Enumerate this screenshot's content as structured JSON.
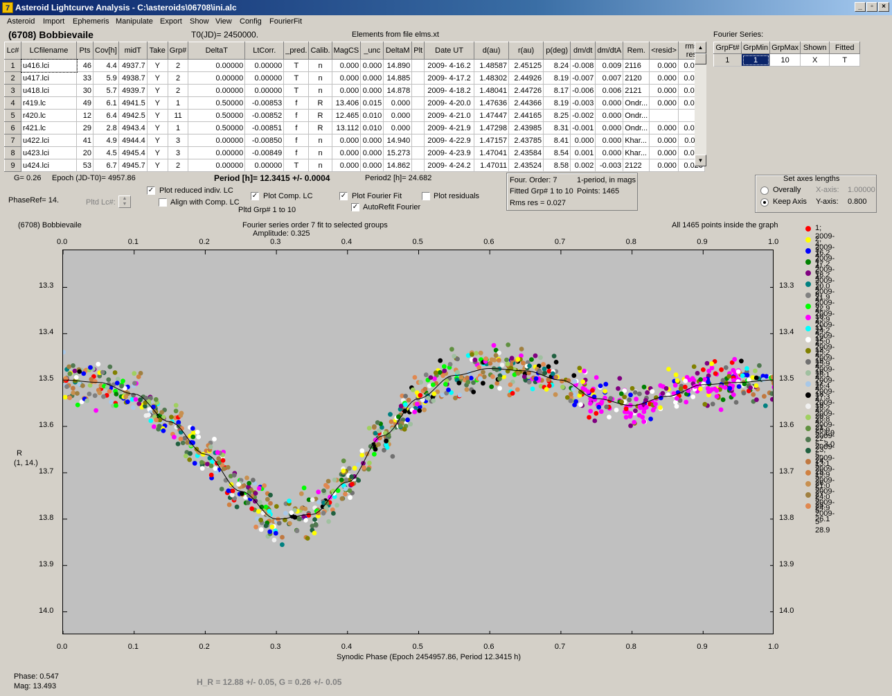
{
  "window": {
    "title": "Asteroid Lightcurve Analysis - C:\\asteroids\\06708\\ini.alc",
    "icon": "app-icon"
  },
  "menu": [
    "Asteroid",
    "Import",
    "Ephemeris",
    "Manipulate",
    "Export",
    "Show",
    "View",
    "Config",
    "FourierFit"
  ],
  "header": {
    "asteroid": "(6708) Bobbievaile",
    "t0": "T0(JD)= 2450000.",
    "elements": "Elements from file elms.xt",
    "fourier_label": "Fourier Series:"
  },
  "table": {
    "columns": [
      "Lc#",
      "LCfilename",
      "Pts",
      "Cov[h]",
      "midT",
      "Take",
      "Grp#",
      "DeltaT",
      "LtCorr.",
      "_pred.",
      "Calib.",
      "MagCS",
      "_unc",
      "DeltaM",
      "Plt",
      "Date UT",
      "d(au)",
      "r(au)",
      "p(deg)",
      "dm/dt",
      "dm/dtA",
      "Rem.",
      "<resid>",
      "rms res"
    ],
    "rows": [
      [
        "1",
        "u416.lci",
        "46",
        "4.4",
        "4937.7",
        "Y",
        "2",
        "0.00000",
        "0.00000",
        "T",
        "n",
        "0.000",
        "0.000",
        "14.890",
        "",
        "2009- 4-16.2",
        "1.48587",
        "2.45125",
        "8.24",
        "-0.008",
        "0.009",
        "2116",
        "0.000",
        "0.024"
      ],
      [
        "2",
        "u417.lci",
        "33",
        "5.9",
        "4938.7",
        "Y",
        "2",
        "0.00000",
        "0.00000",
        "T",
        "n",
        "0.000",
        "0.000",
        "14.885",
        "",
        "2009- 4-17.2",
        "1.48302",
        "2.44926",
        "8.19",
        "-0.007",
        "0.007",
        "2120",
        "0.000",
        "0.029"
      ],
      [
        "3",
        "u418.lci",
        "30",
        "5.7",
        "4939.7",
        "Y",
        "2",
        "0.00000",
        "0.00000",
        "T",
        "n",
        "0.000",
        "0.000",
        "14.878",
        "",
        "2009- 4-18.2",
        "1.48041",
        "2.44726",
        "8.17",
        "-0.006",
        "0.006",
        "2121",
        "0.000",
        "0.022"
      ],
      [
        "4",
        "r419.lc",
        "49",
        "6.1",
        "4941.5",
        "Y",
        "1",
        "0.50000",
        "-0.00853",
        "f",
        "R",
        "13.406",
        "0.015",
        "0.000",
        "",
        "2009- 4-20.0",
        "1.47636",
        "2.44366",
        "8.19",
        "-0.003",
        "0.000",
        "Ondr...",
        "0.000",
        "0.026"
      ],
      [
        "5",
        "r420.lc",
        "12",
        "6.4",
        "4942.5",
        "Y",
        "11",
        "0.50000",
        "-0.00852",
        "f",
        "R",
        "12.465",
        "0.010",
        "0.000",
        "",
        "2009- 4-21.0",
        "1.47447",
        "2.44165",
        "8.25",
        "-0.002",
        "0.000",
        "Ondr...",
        "",
        ""
      ],
      [
        "6",
        "r421.lc",
        "29",
        "2.8",
        "4943.4",
        "Y",
        "1",
        "0.50000",
        "-0.00851",
        "f",
        "R",
        "13.112",
        "0.010",
        "0.000",
        "",
        "2009- 4-21.9",
        "1.47298",
        "2.43985",
        "8.31",
        "-0.001",
        "0.000",
        "Ondr...",
        "0.000",
        "0.017"
      ],
      [
        "7",
        "u422.lci",
        "41",
        "4.9",
        "4944.4",
        "Y",
        "3",
        "0.00000",
        "-0.00850",
        "f",
        "n",
        "0.000",
        "0.000",
        "14.940",
        "",
        "2009- 4-22.9",
        "1.47157",
        "2.43785",
        "8.41",
        "0.000",
        "0.000",
        "Khar...",
        "0.000",
        "0.011"
      ],
      [
        "8",
        "u423.lci",
        "20",
        "4.5",
        "4945.4",
        "Y",
        "3",
        "0.00000",
        "-0.00849",
        "f",
        "n",
        "0.000",
        "0.000",
        "15.273",
        "",
        "2009- 4-23.9",
        "1.47041",
        "2.43584",
        "8.54",
        "0.001",
        "0.000",
        "Khar...",
        "0.000",
        "0.023"
      ],
      [
        "9",
        "u424.lci",
        "53",
        "6.7",
        "4945.7",
        "Y",
        "2",
        "0.00000",
        "0.00000",
        "T",
        "n",
        "0.000",
        "0.000",
        "14.862",
        "",
        "2009- 4-24.2",
        "1.47011",
        "2.43524",
        "8.58",
        "0.002",
        "-0.003",
        "2122",
        "0.000",
        "0.026"
      ]
    ]
  },
  "fourier_table": {
    "columns": [
      "GrpFt#",
      "GrpMin",
      "GrpMax",
      "Shown",
      "Fitted"
    ],
    "row": [
      "1",
      "1",
      "10",
      "X",
      "T"
    ]
  },
  "controls": {
    "g": "G= 0.26",
    "epoch": "Epoch (JD-T0)= 4957.86",
    "period": "Period [h]= 12.3415 +/- 0.0004",
    "period2": "Period2 [h]= 24.682",
    "phaseref": "PhaseRef= 14.",
    "pltd_lc": "Pltd Lc#:",
    "plot_reduced": "Plot reduced indiv. LC",
    "align": "Align with Comp. LC",
    "plot_comp": "Plot Comp. LC",
    "pltd_grp": "Pltd Grp#  1   to   10",
    "plot_fourier": "Plot Fourier Fit",
    "autorefit": "AutoRefit Fourier",
    "plot_resid": "Plot residuals",
    "four_order": "Four. Order:  7",
    "one_period": "1-period, in mags",
    "fitted_grp": "Fitted Grp# 1 to 10",
    "points": "Points: 1465",
    "rms": "Rms res      = 0.027",
    "axes_title": "Set axes lengths",
    "overally": "Overally",
    "keep_axis": "Keep Axis",
    "xaxis_label": "X-axis:",
    "xaxis_val": "1.00000",
    "yaxis_label": "Y-axis:",
    "yaxis_val": "0.800"
  },
  "plot": {
    "left_title": "(6708) Bobbievaile",
    "center_title": "Fourier series order 7 fit to selected groups",
    "amplitude": "Amplitude: 0.325",
    "right_title": "All 1465 points inside the graph",
    "ylabel": "R",
    "ylabel2": "(1, 14.)",
    "xlabel": "Synodic Phase (Epoch 2454957.86, Period 12.3415 h)",
    "phase": "Phase:  0.547",
    "mag": "Mag:    13.493",
    "hr": "H_R = 12.88 +/- 0.05, G = 0.26 +/- 0.05"
  },
  "chart_data": {
    "type": "scatter",
    "title": "Fourier series order 7 fit to selected groups",
    "xlabel": "Synodic Phase (Epoch 2454957.86, Period 12.3415 h)",
    "ylabel": "R",
    "xlim": [
      0.0,
      1.0
    ],
    "ylim": [
      14.05,
      13.22
    ],
    "xticks": [
      "0.0",
      "0.1",
      "0.2",
      "0.3",
      "0.4",
      "0.5",
      "0.6",
      "0.7",
      "0.8",
      "0.9",
      "1.0"
    ],
    "yticks": [
      "13.3",
      "13.4",
      "13.5",
      "13.6",
      "13.7",
      "13.8",
      "13.9",
      "14.0"
    ],
    "fit_curve": {
      "x": [
        0.0,
        0.05,
        0.1,
        0.15,
        0.2,
        0.25,
        0.3,
        0.35,
        0.4,
        0.45,
        0.5,
        0.55,
        0.6,
        0.65,
        0.7,
        0.75,
        0.8,
        0.85,
        0.9,
        0.95,
        1.0
      ],
      "y": [
        13.5,
        13.505,
        13.53,
        13.59,
        13.66,
        13.74,
        13.8,
        13.79,
        13.72,
        13.62,
        13.54,
        13.49,
        13.475,
        13.48,
        13.5,
        13.54,
        13.555,
        13.535,
        13.51,
        13.505,
        13.5
      ]
    },
    "series": [
      {
        "name": "1; 2009- 4-16.2",
        "color": "#ff0000"
      },
      {
        "name": "2; 2009- 4-17.2",
        "color": "#ffff00"
      },
      {
        "name": "3; 2009- 4-18.2",
        "color": "#0000ff"
      },
      {
        "name": "4; 2009- 4-20.0",
        "color": "#008000"
      },
      {
        "name": "6; 2009- 4-21.9",
        "color": "#800080"
      },
      {
        "name": "7; 2009- 4-22.9",
        "color": "#008080"
      },
      {
        "name": "8; 2009- 4-23.9",
        "color": "#808080"
      },
      {
        "name": "9; 2009- 4-24.2",
        "color": "#00ff00"
      },
      {
        "name": "10; 2009- 4-25.0",
        "color": "#ff00ff"
      },
      {
        "name": "11; 2009- 4-25.2",
        "color": "#00ffff"
      },
      {
        "name": "12; 2009- 4-25.9",
        "color": "#ffffff"
      },
      {
        "name": "13; 2009- 4-26.1",
        "color": "#808000"
      },
      {
        "name": "15; 2009- 4-26.4",
        "color": "#707070"
      },
      {
        "name": "16; 2009- 4-27.3",
        "color": "#a0c0a0"
      },
      {
        "name": "17; 2009- 4-28.2",
        "color": "#a8c8e8"
      },
      {
        "name": "18; 2009- 4-28.8",
        "color": "#000000"
      },
      {
        "name": "19; 2009- 4-28.9",
        "color": "#f0f0f0"
      },
      {
        "name": "20; 2009- 5- 1.9",
        "color": "#a0d060"
      },
      {
        "name": "21; 2009- 5- 3.0",
        "color": "#609040"
      },
      {
        "name": "22; 2009- 5-13.1",
        "color": "#507850"
      },
      {
        "name": "23; 2009- 5-19.9",
        "color": "#206040"
      },
      {
        "name": "24; 2009- 5-21.0",
        "color": "#c07840"
      },
      {
        "name": "25; 2009- 5-24.0",
        "color": "#d08040"
      },
      {
        "name": "26; 2009- 5-24.9",
        "color": "#c89050"
      },
      {
        "name": "27; 2009- 5-26.1",
        "color": "#a08040"
      },
      {
        "name": "28; 2009- 5-28.9",
        "color": "#e08850"
      }
    ]
  }
}
